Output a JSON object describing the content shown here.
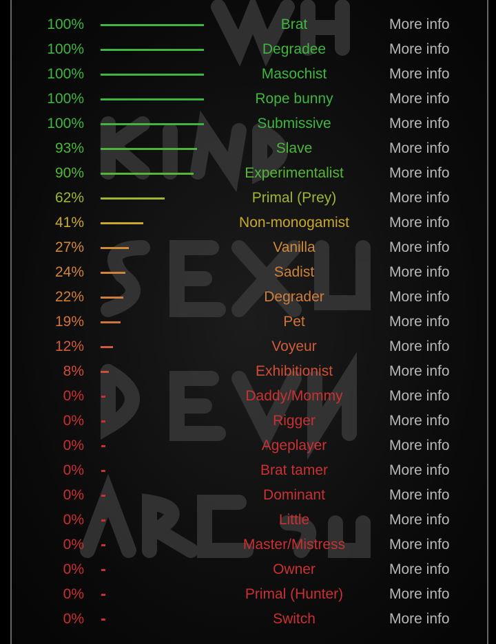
{
  "background_watermark": "WHAT KIND OF SEXUAL DEVIANT ARE YOU",
  "more_info_label": "More info",
  "results": [
    {
      "percent": 100,
      "label": "100%",
      "name": "Brat",
      "color": "#3fb63f"
    },
    {
      "percent": 100,
      "label": "100%",
      "name": "Degradee",
      "color": "#3fb63f"
    },
    {
      "percent": 100,
      "label": "100%",
      "name": "Masochist",
      "color": "#3fb63f"
    },
    {
      "percent": 100,
      "label": "100%",
      "name": "Rope bunny",
      "color": "#3fb63f"
    },
    {
      "percent": 100,
      "label": "100%",
      "name": "Submissive",
      "color": "#3fb63f"
    },
    {
      "percent": 93,
      "label": "93%",
      "name": "Slave",
      "color": "#4cb63a"
    },
    {
      "percent": 90,
      "label": "90%",
      "name": "Experimentalist",
      "color": "#55b638"
    },
    {
      "percent": 62,
      "label": "62%",
      "name": "Primal (Prey)",
      "color": "#9cb830"
    },
    {
      "percent": 41,
      "label": "41%",
      "name": "Non-monogamist",
      "color": "#c9a82c"
    },
    {
      "percent": 27,
      "label": "27%",
      "name": "Vanilla",
      "color": "#d08a3a"
    },
    {
      "percent": 24,
      "label": "24%",
      "name": "Sadist",
      "color": "#d0843a"
    },
    {
      "percent": 22,
      "label": "22%",
      "name": "Degrader",
      "color": "#d07e3a"
    },
    {
      "percent": 19,
      "label": "19%",
      "name": "Pet",
      "color": "#d0743a"
    },
    {
      "percent": 12,
      "label": "12%",
      "name": "Voyeur",
      "color": "#d05c3a"
    },
    {
      "percent": 8,
      "label": "8%",
      "name": "Exhibitionist",
      "color": "#d04e38"
    },
    {
      "percent": 0,
      "label": "0%",
      "name": "Daddy/Mommy",
      "color": "#c83232"
    },
    {
      "percent": 0,
      "label": "0%",
      "name": "Rigger",
      "color": "#c83232"
    },
    {
      "percent": 0,
      "label": "0%",
      "name": "Ageplayer",
      "color": "#c83232"
    },
    {
      "percent": 0,
      "label": "0%",
      "name": "Brat tamer",
      "color": "#c83232"
    },
    {
      "percent": 0,
      "label": "0%",
      "name": "Dominant",
      "color": "#c83232"
    },
    {
      "percent": 0,
      "label": "0%",
      "name": "Little",
      "color": "#c83232"
    },
    {
      "percent": 0,
      "label": "0%",
      "name": "Master/Mistress",
      "color": "#c83232"
    },
    {
      "percent": 0,
      "label": "0%",
      "name": "Owner",
      "color": "#c83232"
    },
    {
      "percent": 0,
      "label": "0%",
      "name": "Primal (Hunter)",
      "color": "#c83232"
    },
    {
      "percent": 0,
      "label": "0%",
      "name": "Switch",
      "color": "#c83232"
    }
  ]
}
